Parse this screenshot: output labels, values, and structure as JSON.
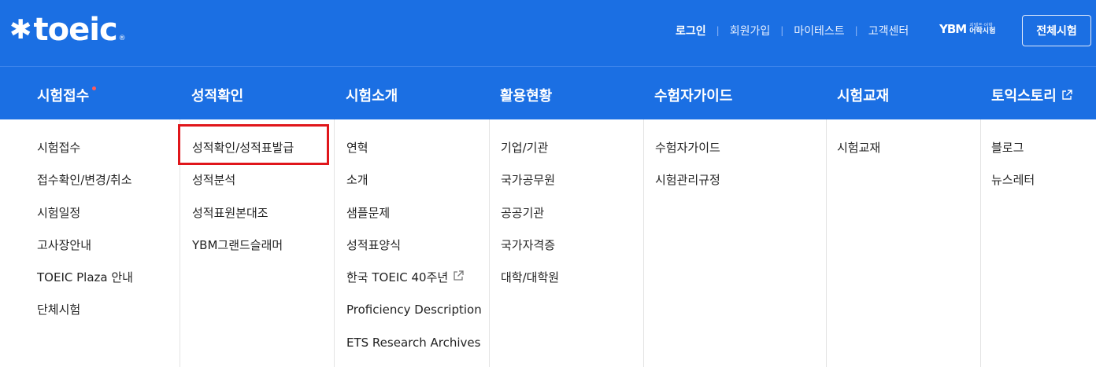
{
  "header": {
    "logo_text": "toeic",
    "logo_reg": "®",
    "util_links": [
      "로그인",
      "회원가입",
      "마이테스트",
      "고객센터"
    ],
    "ybm_mark": "YBM",
    "ybm_sub_small": "지텔프·어학",
    "ybm_sub_big": "어학시험",
    "all_exams_button": "전체시험"
  },
  "gnb": {
    "items": [
      "시험접수",
      "성적확인",
      "시험소개",
      "활용현황",
      "수험자가이드",
      "시험교재",
      "토익스토리"
    ]
  },
  "submenu": {
    "col1": [
      "시험접수",
      "접수확인/변경/취소",
      "시험일정",
      "고사장안내",
      "TOEIC Plaza 안내",
      "단체시험"
    ],
    "col2": [
      "성적확인/성적표발급",
      "성적분석",
      "성적표원본대조",
      "YBM그랜드슬래머"
    ],
    "col3": [
      "연혁",
      "소개",
      "샘플문제",
      "성적표양식",
      "한국 TOEIC 40주년",
      "Proficiency Description",
      "ETS Research Archives"
    ],
    "col4": [
      "기업/기관",
      "국가공무원",
      "공공기관",
      "국가자격증",
      "대학/대학원"
    ],
    "col5": [
      "수험자가이드",
      "시험관리규정"
    ],
    "col6": [
      "시험교재"
    ],
    "col7": [
      "블로그",
      "뉴스레터"
    ]
  },
  "colors": {
    "header_bg": "#1b6fe3",
    "highlight": "#e0161b",
    "notice_dot": "#ff5b5b"
  },
  "icons": {
    "external_link": "external-link-icon",
    "logo_star": "asterisk-logo-icon"
  }
}
